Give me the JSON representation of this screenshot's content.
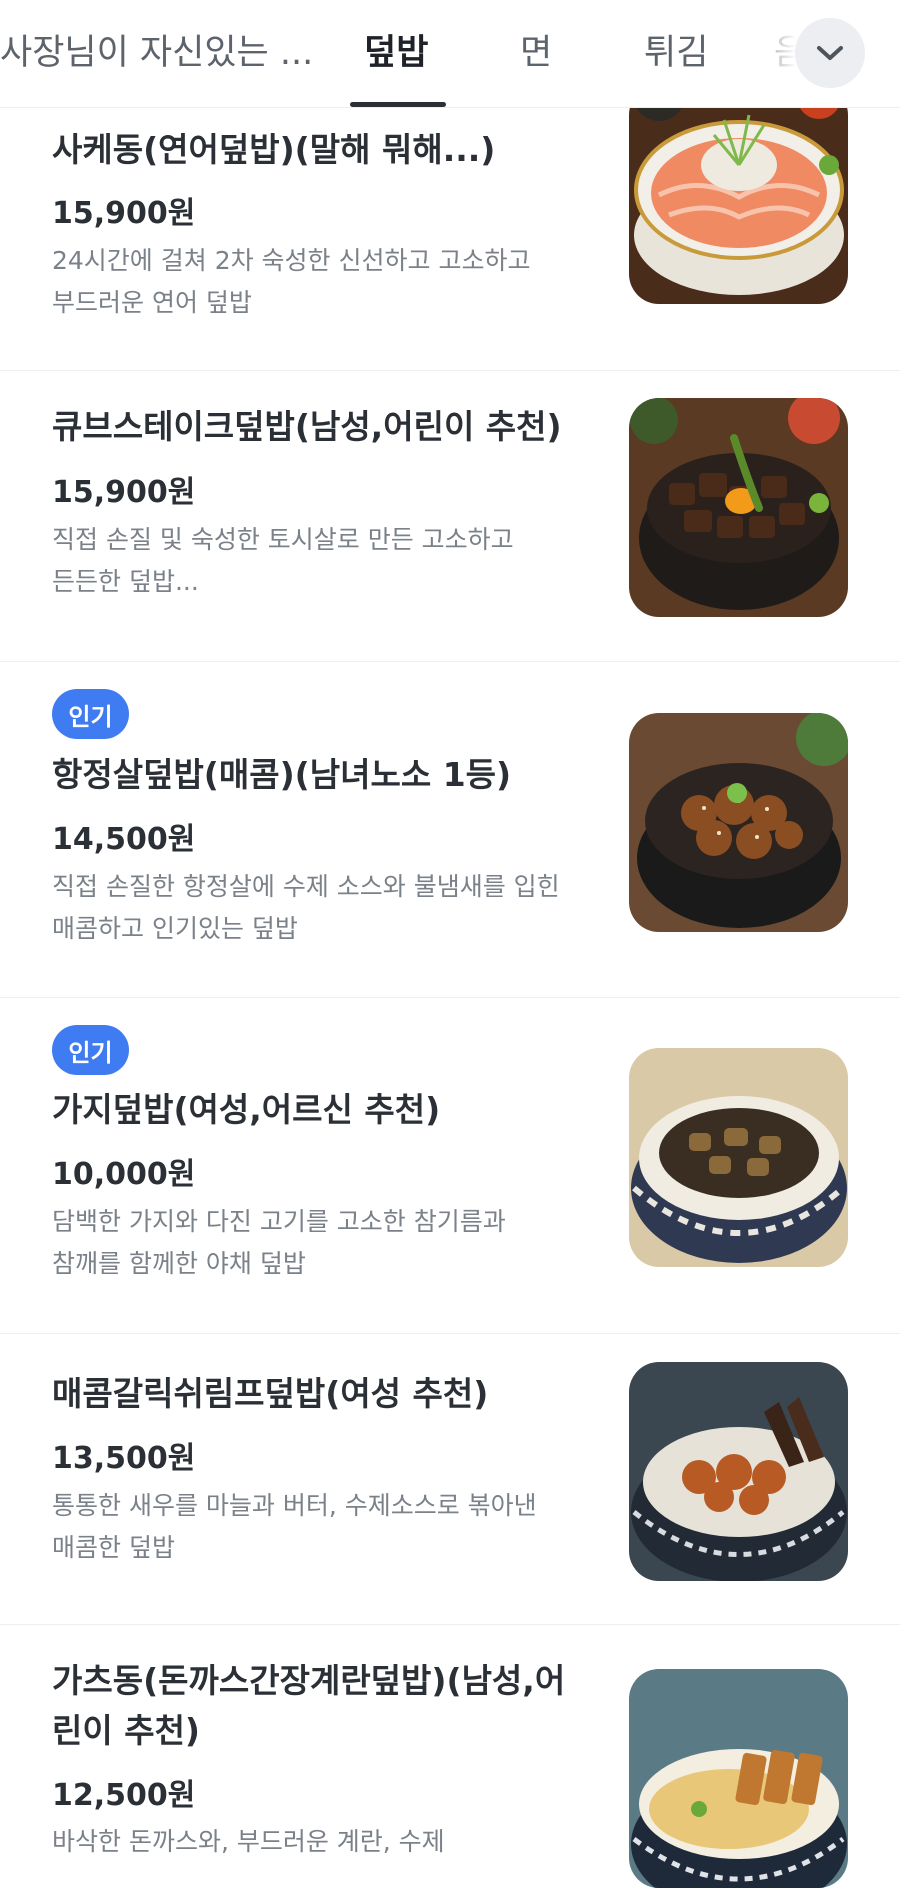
{
  "tabs": [
    {
      "label": "사장님이 자신있는 ...",
      "active": false
    },
    {
      "label": "덮밥",
      "active": true
    },
    {
      "label": "면",
      "active": false
    },
    {
      "label": "튀김",
      "active": false
    },
    {
      "label": "음",
      "active": false
    }
  ],
  "expand_icon": "chevron-down-icon",
  "accent_color": "#3f7cf2",
  "menu": [
    {
      "badge": "",
      "name": "사케동(연어덮밥)(말해 뭐해...)",
      "price": "15,900원",
      "desc": "24시간에 걸쳐 2차 숙성한 신선하고 고소하고\n부드러운 연어 덮밥",
      "image": "salmon-rice-bowl-photo"
    },
    {
      "badge": "",
      "name": "큐브스테이크덮밥(남성,어린이 추천)",
      "price": "15,900원",
      "desc": "직접 손질 및 숙성한 토시살로 만든 고소하고\n든든한 덮밥...",
      "image": "cube-steak-rice-bowl-photo"
    },
    {
      "badge": "인기",
      "name": "항정살덮밥(매콤)(남녀노소 1등)",
      "price": "14,500원",
      "desc": "직접 손질한 항정살에 수제 소스와 불냄새를 입힌\n매콤하고 인기있는 덮밥",
      "image": "pork-jowl-rice-bowl-photo"
    },
    {
      "badge": "인기",
      "name": "가지덮밥(여성,어르신 추천)",
      "price": "10,000원",
      "desc": "담백한 가지와 다진 고기를 고소한 참기름과\n참깨를 함께한 야채 덮밥",
      "image": "eggplant-rice-bowl-photo"
    },
    {
      "badge": "",
      "name": "매콤갈릭쉬림프덮밥(여성 추천)",
      "price": "13,500원",
      "desc": "통통한 새우를 마늘과 버터, 수제소스로 볶아낸\n매콤한 덮밥",
      "image": "garlic-shrimp-rice-bowl-photo"
    },
    {
      "badge": "",
      "name": "가츠동(돈까스간장계란덮밥)(남성,어\n린이 추천)",
      "price": "12,500원",
      "desc": "바삭한 돈까스와, 부드러운 계란, 수제",
      "image": "katsudon-rice-bowl-photo"
    }
  ]
}
